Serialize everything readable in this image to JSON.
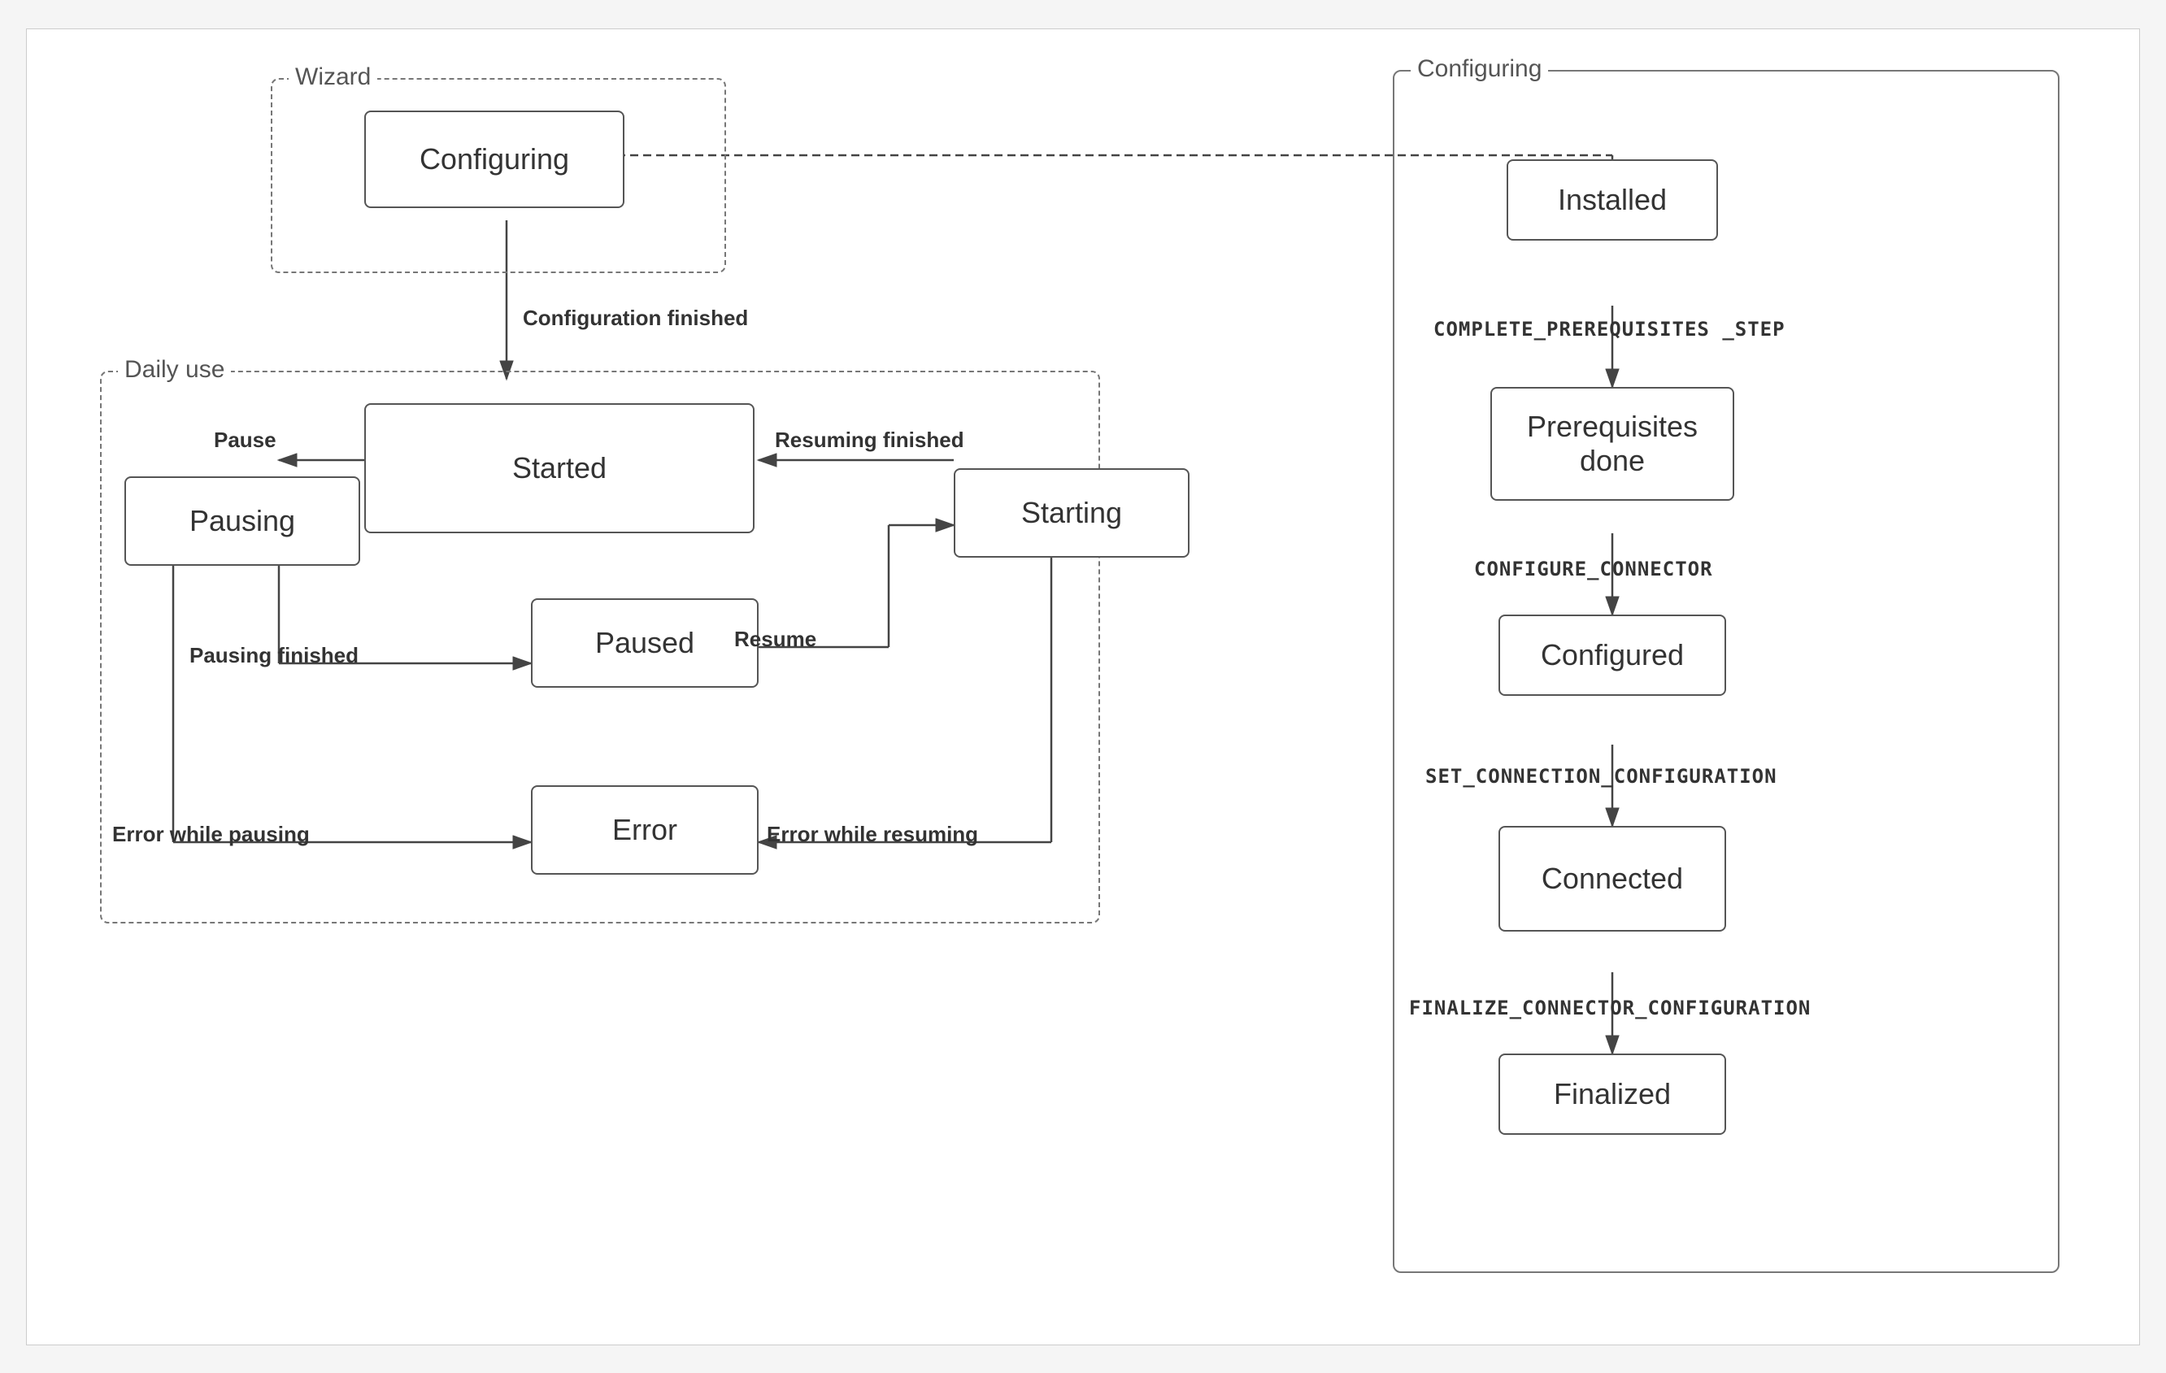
{
  "wizard_box": {
    "label": "Wizard"
  },
  "daily_box": {
    "label": "Daily use"
  },
  "configuring_section": {
    "label": "Configuring"
  },
  "states": {
    "wizard_configuring": "Configuring",
    "started": "Started",
    "pausing": "Pausing",
    "paused": "Paused",
    "starting": "Starting",
    "error": "Error",
    "installed": "Installed",
    "prerequisites_done": "Prerequisites\ndone",
    "configured": "Configured",
    "connected": "Connected",
    "finalized": "Finalized"
  },
  "transitions": {
    "config_finished": "Configuration finished",
    "pause": "Pause",
    "pausing_finished": "Pausing finished",
    "resume": "Resume",
    "resuming_finished": "Resuming finished",
    "error_while_pausing": "Error while pausing",
    "error_while_resuming": "Error while resuming",
    "complete_prereq": "COMPLETE_PREREQUISITES _STEP",
    "configure_connector": "CONFIGURE_CONNECTOR",
    "set_connection": "SET_CONNECTION_CONFIGURATION",
    "finalize_connector": "FINALIZE_CONNECTOR_CONFIGURATION"
  }
}
